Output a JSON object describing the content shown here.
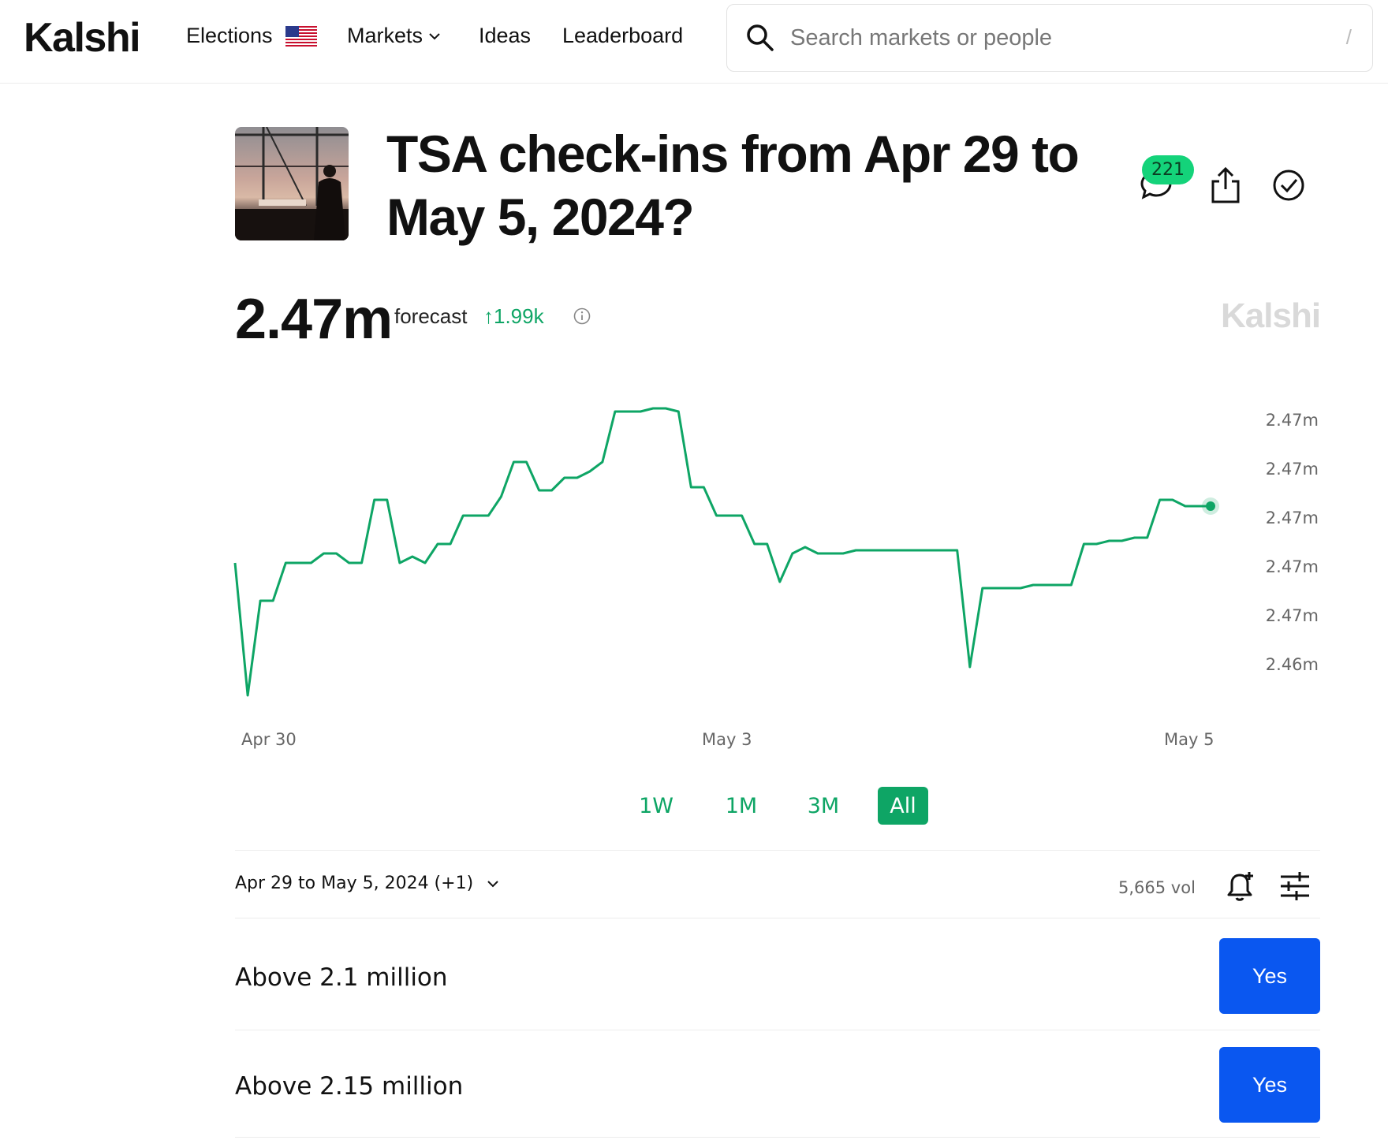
{
  "header": {
    "logo": "Kalshi",
    "nav": {
      "elections": "Elections",
      "markets": "Markets",
      "ideas": "Ideas",
      "leaderboard": "Leaderboard"
    },
    "search": {
      "placeholder": "Search markets or people",
      "shortcut": "/"
    }
  },
  "market": {
    "title": "TSA check-ins from Apr 29 to May 5, 2024?",
    "comment_count": "221",
    "forecast_value": "2.47m",
    "forecast_label": "forecast",
    "forecast_delta": "↑1.99k",
    "watermark": "Kalshi"
  },
  "range_tabs": [
    {
      "label": "1W",
      "active": false
    },
    {
      "label": "1M",
      "active": false
    },
    {
      "label": "3M",
      "active": false
    },
    {
      "label": "All",
      "active": true
    }
  ],
  "market_meta": {
    "date_selector": "Apr 29 to May 5, 2024 (+1)",
    "volume": "5,665 vol"
  },
  "outcomes": [
    {
      "label": "Above 2.1 million",
      "button": "Yes"
    },
    {
      "label": "Above 2.15 million",
      "button": "Yes"
    }
  ],
  "colors": {
    "accent_green": "#0ea565",
    "yes_blue": "#0a57f0",
    "badge_green": "#14d37a"
  },
  "chart_data": {
    "type": "line",
    "x_tick_labels": [
      "Apr 30",
      "May 3",
      "May 5"
    ],
    "y_tick_labels": [
      "2.47m",
      "2.47m",
      "2.47m",
      "2.47m",
      "2.47m",
      "2.46m"
    ],
    "y_scale_note": "relative index 0-100 (tick labels rounded)",
    "ylim": [
      0,
      100
    ],
    "series": [
      {
        "values": [
          44,
          2,
          32,
          32,
          44,
          44,
          44,
          47,
          47,
          44,
          44,
          64,
          64,
          44,
          46,
          44,
          50,
          50,
          59,
          59,
          59,
          65,
          76,
          76,
          67,
          67,
          71,
          71,
          73,
          76,
          92,
          92,
          92,
          93,
          93,
          92,
          68,
          68,
          59,
          59,
          59,
          50,
          50,
          38,
          47,
          49,
          47,
          47,
          47,
          48,
          48,
          48,
          48,
          48,
          48,
          48,
          48,
          48,
          11,
          36,
          36,
          36,
          36,
          37,
          37,
          37,
          37,
          50,
          50,
          51,
          51,
          52,
          52,
          64,
          64,
          62,
          62,
          62
        ]
      }
    ],
    "grid": false,
    "legend": "none"
  }
}
